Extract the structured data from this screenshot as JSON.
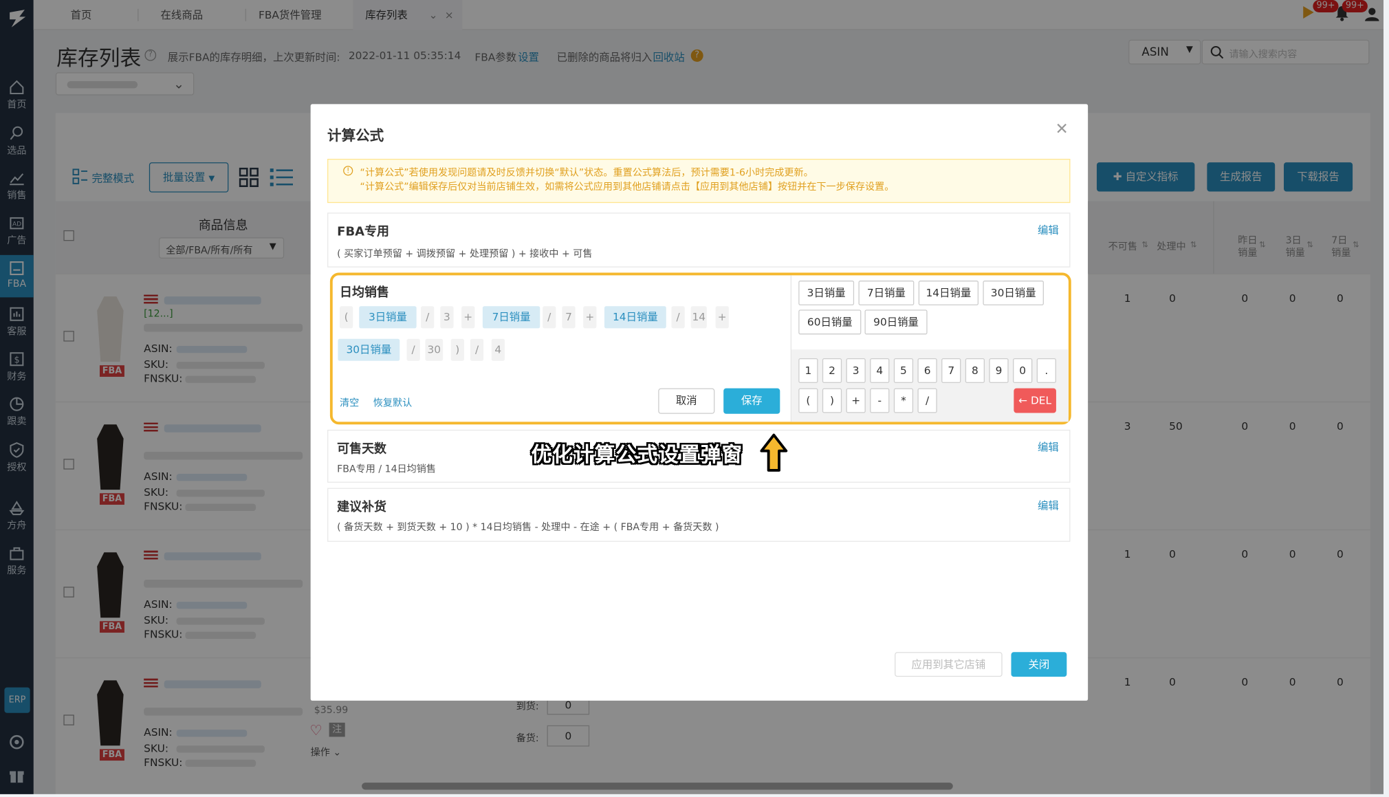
{
  "sidebar": {
    "items": [
      {
        "label": "首页",
        "icon": "home-icon"
      },
      {
        "label": "选品",
        "icon": "search-icon"
      },
      {
        "label": "销售",
        "icon": "chart-icon"
      },
      {
        "label": "广告",
        "icon": "ad-icon"
      },
      {
        "label": "FBA",
        "icon": "fba-icon"
      },
      {
        "label": "客服",
        "icon": "report-icon"
      },
      {
        "label": "财务",
        "icon": "dollar-icon"
      },
      {
        "label": "跟卖",
        "icon": "pie-icon"
      },
      {
        "label": "授权",
        "icon": "shield-icon"
      },
      {
        "label": "方舟",
        "icon": "ark-icon"
      },
      {
        "label": "服务",
        "icon": "service-icon"
      }
    ],
    "erp": "ERP"
  },
  "tabs": [
    "首页",
    "在线商品",
    "FBA货件管理",
    "库存列表"
  ],
  "badges": [
    "99+",
    "99+"
  ],
  "page": {
    "title": "库存列表",
    "desc": "展示FBA的库存明细，上次更新时间:",
    "updated": "2022-01-11 05:35:14",
    "fba_param": "FBA参数",
    "set_link": "设置",
    "deleted_note": "已删除的商品将归入",
    "recycle": "回收站",
    "search_type": "ASIN",
    "search_placeholder": "请输入搜索内容",
    "mode": "完整模式",
    "batch": "批量设置",
    "custom": "自定义指标",
    "gen_report": "生成报告",
    "dl_report": "下载报告",
    "col_product": "商品信息",
    "filter": "全部/FBA/所有/所有",
    "cols": [
      "不可售",
      "处理中",
      "昨日销量",
      "3日销量",
      "7日销量"
    ],
    "price": "$35.99",
    "ops": "操作",
    "arrive": "到货:",
    "stock": "备货:",
    "zero": "0",
    "row_labels": {
      "asin": "ASIN:",
      "sku": "SKU:",
      "fnsku": "FNSKU:",
      "fba": "FBA",
      "partial": "[12...]"
    },
    "rows": [
      {
        "nums": [
          "1",
          "0",
          "0",
          "0",
          "0"
        ]
      },
      {
        "nums": [
          "3",
          "50",
          "0",
          "0",
          "0"
        ]
      },
      {
        "nums": [
          "1",
          "0",
          "0",
          "0",
          "0"
        ]
      },
      {
        "nums": [
          "1",
          "0",
          "0",
          "0",
          "0"
        ]
      }
    ]
  },
  "modal": {
    "title": "计算公式",
    "notice1": "“计算公式”若使用发现问题请及时反馈并切换“默认”状态。重置公式算法后，预计需要1-6小时完成更新。",
    "notice2": "“计算公式”编辑保存后仅对当前店铺生效，如需将公式应用到其他店铺请点击【应用到其他店铺】按钮并在下一步保存设置。",
    "edit": "编辑",
    "sec_fba": {
      "title": "FBA专用",
      "formula": "( 买家订单预留 + 调拨预留 + 处理预留 ) + 接收中 + 可售"
    },
    "sec_daily": {
      "title": "日均销售",
      "chips1": [
        "(",
        "3日销量",
        "/",
        "3",
        "+",
        "7日销量",
        "/",
        "7",
        "+",
        "14日销量",
        "/",
        "14",
        "+"
      ],
      "chips2": [
        "30日销量",
        "/",
        "30",
        ")",
        "/",
        "4"
      ],
      "clear": "清空",
      "reset": "恢复默认",
      "cancel": "取消",
      "save": "保存",
      "vars": [
        "3日销量",
        "7日销量",
        "14日销量",
        "30日销量",
        "60日销量",
        "90日销量"
      ],
      "keys1": [
        "1",
        "2",
        "3",
        "4",
        "5",
        "6",
        "7",
        "8",
        "9",
        "0",
        "."
      ],
      "keys2": [
        "(",
        ")",
        "+",
        "-",
        "*",
        "/"
      ],
      "del": "← DEL"
    },
    "sec_days": {
      "title": "可售天数",
      "formula": "FBA专用 / 14日均销售"
    },
    "sec_restock": {
      "title": "建议补货",
      "formula": "( 备货天数 + 到货天数 + 10 ) * 14日均销售 - 处理中 - 在途 + ( FBA专用 + 备货天数 )"
    },
    "apply": "应用到其它店铺",
    "close": "关闭"
  },
  "callout": "优化计算公式设置弹窗",
  "colors": {
    "accent": "#2b8fbf",
    "highlight": "#f5b82e",
    "danger": "#f05a5a"
  }
}
